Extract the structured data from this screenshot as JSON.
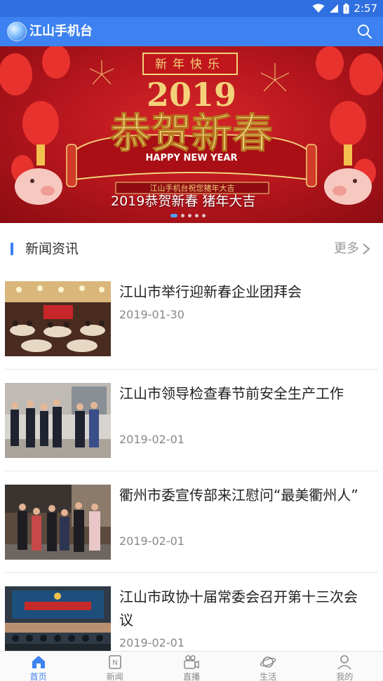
{
  "status_bar": {
    "time": "2:57",
    "icons": [
      "wifi-icon",
      "signal-icon",
      "battery-icon"
    ]
  },
  "app_bar": {
    "title": "江山手机台",
    "search_icon": "search-icon"
  },
  "banner": {
    "caption": "2019恭贺新春    猪年大吉",
    "art_top": "新年快乐",
    "art_year": "2019",
    "art_main": "恭贺新春",
    "art_sub": "HAPPY NEW YEAR",
    "art_scroll": "江山手机台祝您猪年大吉",
    "slides_count": 5,
    "active_slide": 1
  },
  "section": {
    "title": "新闻资讯",
    "more": "更多"
  },
  "news": [
    {
      "title": "江山市举行迎新春企业团拜会",
      "date": "2019-01-30",
      "thumb": "banquet-photo"
    },
    {
      "title": "江山市领导检查春节前安全生产工作",
      "date": "2019-02-01",
      "thumb": "inspection-photo"
    },
    {
      "title": "衢州市委宣传部来江慰问“最美衢州人”",
      "date": "2019-02-01",
      "thumb": "street-visit-photo"
    },
    {
      "title": "江山市政协十届常委会召开第十三次会议",
      "date": "2019-02-01",
      "thumb": "meeting-photo"
    }
  ],
  "bottom_nav": [
    {
      "label": "首页",
      "icon": "home-icon",
      "active": true
    },
    {
      "label": "新闻",
      "icon": "news-icon",
      "active": false
    },
    {
      "label": "直播",
      "icon": "live-camera-icon",
      "active": false
    },
    {
      "label": "生活",
      "icon": "planet-icon",
      "active": false
    },
    {
      "label": "我的",
      "icon": "user-icon",
      "active": false
    }
  ],
  "colors": {
    "primary": "#3d82f0",
    "status_bar": "#2f6fe0",
    "banner_red": "#c41a20",
    "gold": "#f3d27a"
  }
}
